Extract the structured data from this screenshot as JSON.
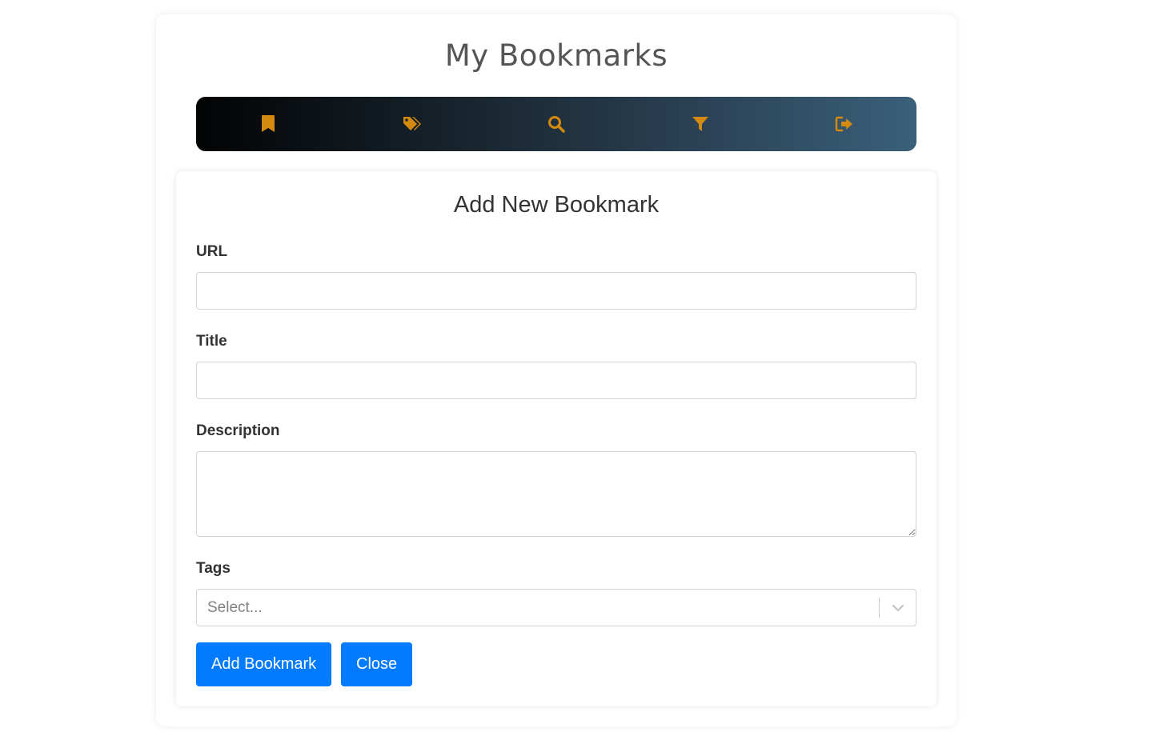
{
  "app": {
    "title": "My Bookmarks"
  },
  "navbar": {
    "icon_color": "#d4890f",
    "items": [
      {
        "icon": "bookmark-icon"
      },
      {
        "icon": "tags-icon"
      },
      {
        "icon": "search-icon"
      },
      {
        "icon": "filter-icon"
      },
      {
        "icon": "sign-out-icon"
      }
    ]
  },
  "form": {
    "title": "Add New Bookmark",
    "url": {
      "label": "URL",
      "value": ""
    },
    "title_field": {
      "label": "Title",
      "value": ""
    },
    "description": {
      "label": "Description",
      "value": ""
    },
    "tags": {
      "label": "Tags",
      "placeholder": "Select..."
    },
    "buttons": {
      "submit_label": "Add Bookmark",
      "close_label": "Close"
    },
    "accent_color": "#007bff"
  }
}
